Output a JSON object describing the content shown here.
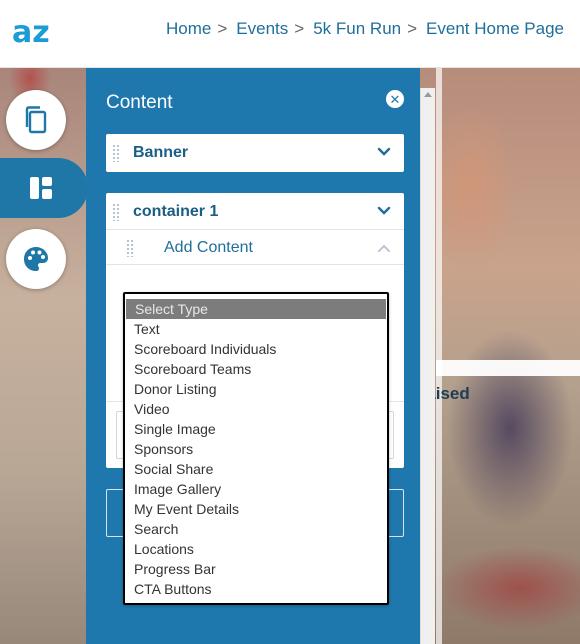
{
  "header": {
    "logo_text": "az",
    "breadcrumbs": [
      {
        "label": "Home",
        "sep": ">"
      },
      {
        "label": "Events",
        "sep": ">"
      },
      {
        "label": "5k Fun Run",
        "sep": ">"
      },
      {
        "label": "Event Home Page",
        "sep": ""
      }
    ]
  },
  "rail": {
    "items": [
      {
        "name": "pages-icon"
      },
      {
        "name": "layout-icon",
        "active": true
      },
      {
        "name": "palette-icon"
      }
    ]
  },
  "panel": {
    "title": "Content",
    "sections": [
      {
        "label": "Banner"
      },
      {
        "label": "container 1",
        "add_content_label": "Add Content"
      }
    ]
  },
  "background_text": {
    "raised": "Raised"
  },
  "dropdown": {
    "selected": "Select Type",
    "options": [
      "Select Type",
      "Text",
      "Scoreboard Individuals",
      "Scoreboard Teams",
      "Donor Listing",
      "Video",
      "Single Image",
      "Sponsors",
      "Social Share",
      "Image Gallery",
      "My Event Details",
      "Search",
      "Locations",
      "Progress Bar",
      "CTA Buttons"
    ]
  },
  "colors": {
    "panel": "#1f78ad",
    "brand": "#1f6e9b",
    "section_label": "#1a5e86"
  }
}
